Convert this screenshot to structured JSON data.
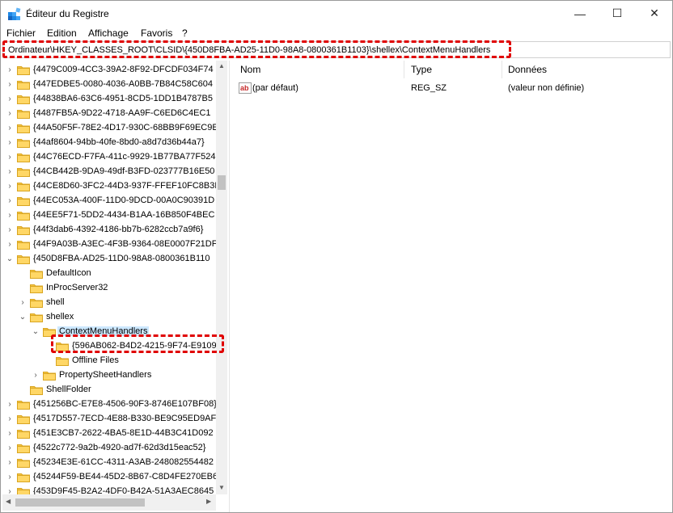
{
  "window": {
    "title": "Éditeur du Registre",
    "minimize_symbol": "—",
    "maximize_symbol": "☐",
    "close_symbol": "✕"
  },
  "menu": [
    "Fichier",
    "Edition",
    "Affichage",
    "Favoris",
    "?"
  ],
  "address_bar": {
    "path": "Ordinateur\\HKEY_CLASSES_ROOT\\CLSID\\{450D8FBA-AD25-11D0-98A8-0800361B1103}\\shellex\\ContextMenuHandlers"
  },
  "tree": {
    "items": [
      {
        "label": "{4479C009-4CC3-39A2-8F92-DFCDF034F74",
        "level": 0,
        "expanded": false
      },
      {
        "label": "{447EDBE5-0080-4036-A0BB-7B84C58C604",
        "level": 0,
        "expanded": false
      },
      {
        "label": "{44838BA6-63C6-4951-8CD5-1DD1B4787B5",
        "level": 0,
        "expanded": false
      },
      {
        "label": "{4487FB5A-9D22-4718-AA9F-C6ED6C4EC1",
        "level": 0,
        "expanded": false
      },
      {
        "label": "{44A50F5F-78E2-4D17-930C-68BB9F69EC9E",
        "level": 0,
        "expanded": false
      },
      {
        "label": "{44af8604-94bb-40fe-8bd0-a8d7d36b44a7}",
        "level": 0,
        "expanded": false
      },
      {
        "label": "{44C76ECD-F7FA-411c-9929-1B77BA77F524",
        "level": 0,
        "expanded": false
      },
      {
        "label": "{44CB442B-9DA9-49df-B3FD-023777B16E50",
        "level": 0,
        "expanded": false
      },
      {
        "label": "{44CE8D60-3FC2-44D3-937F-FFEF10FC8B3F",
        "level": 0,
        "expanded": false
      },
      {
        "label": "{44EC053A-400F-11D0-9DCD-00A0C90391D",
        "level": 0,
        "expanded": false
      },
      {
        "label": "{44EE5F71-5DD2-4434-B1AA-16B850F4BEC",
        "level": 0,
        "expanded": false
      },
      {
        "label": "{44f3dab6-4392-4186-bb7b-6282ccb7a9f6}",
        "level": 0,
        "expanded": false
      },
      {
        "label": "{44F9A03B-A3EC-4F3B-9364-08E0007F21DF",
        "level": 0,
        "expanded": false
      },
      {
        "label": "{450D8FBA-AD25-11D0-98A8-0800361B110",
        "level": 0,
        "expanded": true
      },
      {
        "label": "DefaultIcon",
        "level": 1,
        "expanded": null
      },
      {
        "label": "InProcServer32",
        "level": 1,
        "expanded": null
      },
      {
        "label": "shell",
        "level": 1,
        "expanded": false
      },
      {
        "label": "shellex",
        "level": 1,
        "expanded": true
      },
      {
        "label": "ContextMenuHandlers",
        "level": 2,
        "expanded": true,
        "selected": true
      },
      {
        "label": "{596AB062-B4D2-4215-9F74-E9109",
        "level": 3,
        "expanded": null
      },
      {
        "label": "Offline Files",
        "level": 3,
        "expanded": null
      },
      {
        "label": "PropertySheetHandlers",
        "level": 2,
        "expanded": false
      },
      {
        "label": "ShellFolder",
        "level": 1,
        "expanded": null
      },
      {
        "label": "{451256BC-E7E8-4506-90F3-8746E107BF08}",
        "level": 0,
        "expanded": false
      },
      {
        "label": "{4517D557-7ECD-4E88-B330-BE9C95ED9AF",
        "level": 0,
        "expanded": false
      },
      {
        "label": "{451E3CB7-2622-4BA5-8E1D-44B3C41D092",
        "level": 0,
        "expanded": false
      },
      {
        "label": "{4522c772-9a2b-4920-ad7f-62d3d15eac52}",
        "level": 0,
        "expanded": false
      },
      {
        "label": "{45234E3E-61CC-4311-A3AB-248082554482",
        "level": 0,
        "expanded": false
      },
      {
        "label": "{45244F59-BE44-45D2-8B67-C8D4FE270EB6",
        "level": 0,
        "expanded": false
      },
      {
        "label": "{453D9F45-B2A2-4DF0-B42A-51A3AEC8645",
        "level": 0,
        "expanded": false
      }
    ]
  },
  "values_pane": {
    "columns": [
      "Nom",
      "Type",
      "Données"
    ],
    "rows": [
      {
        "name": "(par défaut)",
        "type": "REG_SZ",
        "data": "(valeur non définie)"
      }
    ]
  },
  "colors": {
    "highlight": "#e00000",
    "selection": "#cce8ff",
    "folder": "#f5c542"
  }
}
